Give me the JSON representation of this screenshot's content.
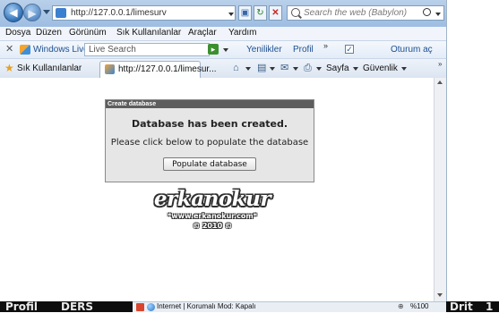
{
  "browser": {
    "url": "http://127.0.0.1/limesurv",
    "search_placeholder": "Search the web (Babylon)"
  },
  "menu": {
    "items": [
      "Dosya",
      "Düzen",
      "Görünüm",
      "Sık Kullanılanlar",
      "Araçlar",
      "Yardım"
    ]
  },
  "live_toolbar": {
    "brand": "Windows Live",
    "search_placeholder": "Live Search",
    "links": [
      "Yenilikler",
      "Profil",
      "Oturum aç"
    ],
    "more": "»"
  },
  "favorites_bar": {
    "favorites_label": "Sık Kullanılanlar",
    "tab_title": "http://127.0.0.1/limesur...",
    "page_menu": "Sayfa",
    "security_menu": "Güvenlik",
    "more": "»"
  },
  "dialog": {
    "title": "Create database",
    "heading": "Database has been created.",
    "body": "Please click below to populate the database",
    "button": "Populate database"
  },
  "logo": {
    "name": "erkanokur",
    "url": "*www.erkanokur.com*",
    "year": "© 2010 ©"
  },
  "status_bar": {
    "zone": "Internet | Korumalı Mod: Kapalı",
    "zoom": "%100"
  },
  "taskbar": {
    "fragments": [
      "Profil",
      "DERS",
      "Drit",
      "1"
    ]
  }
}
